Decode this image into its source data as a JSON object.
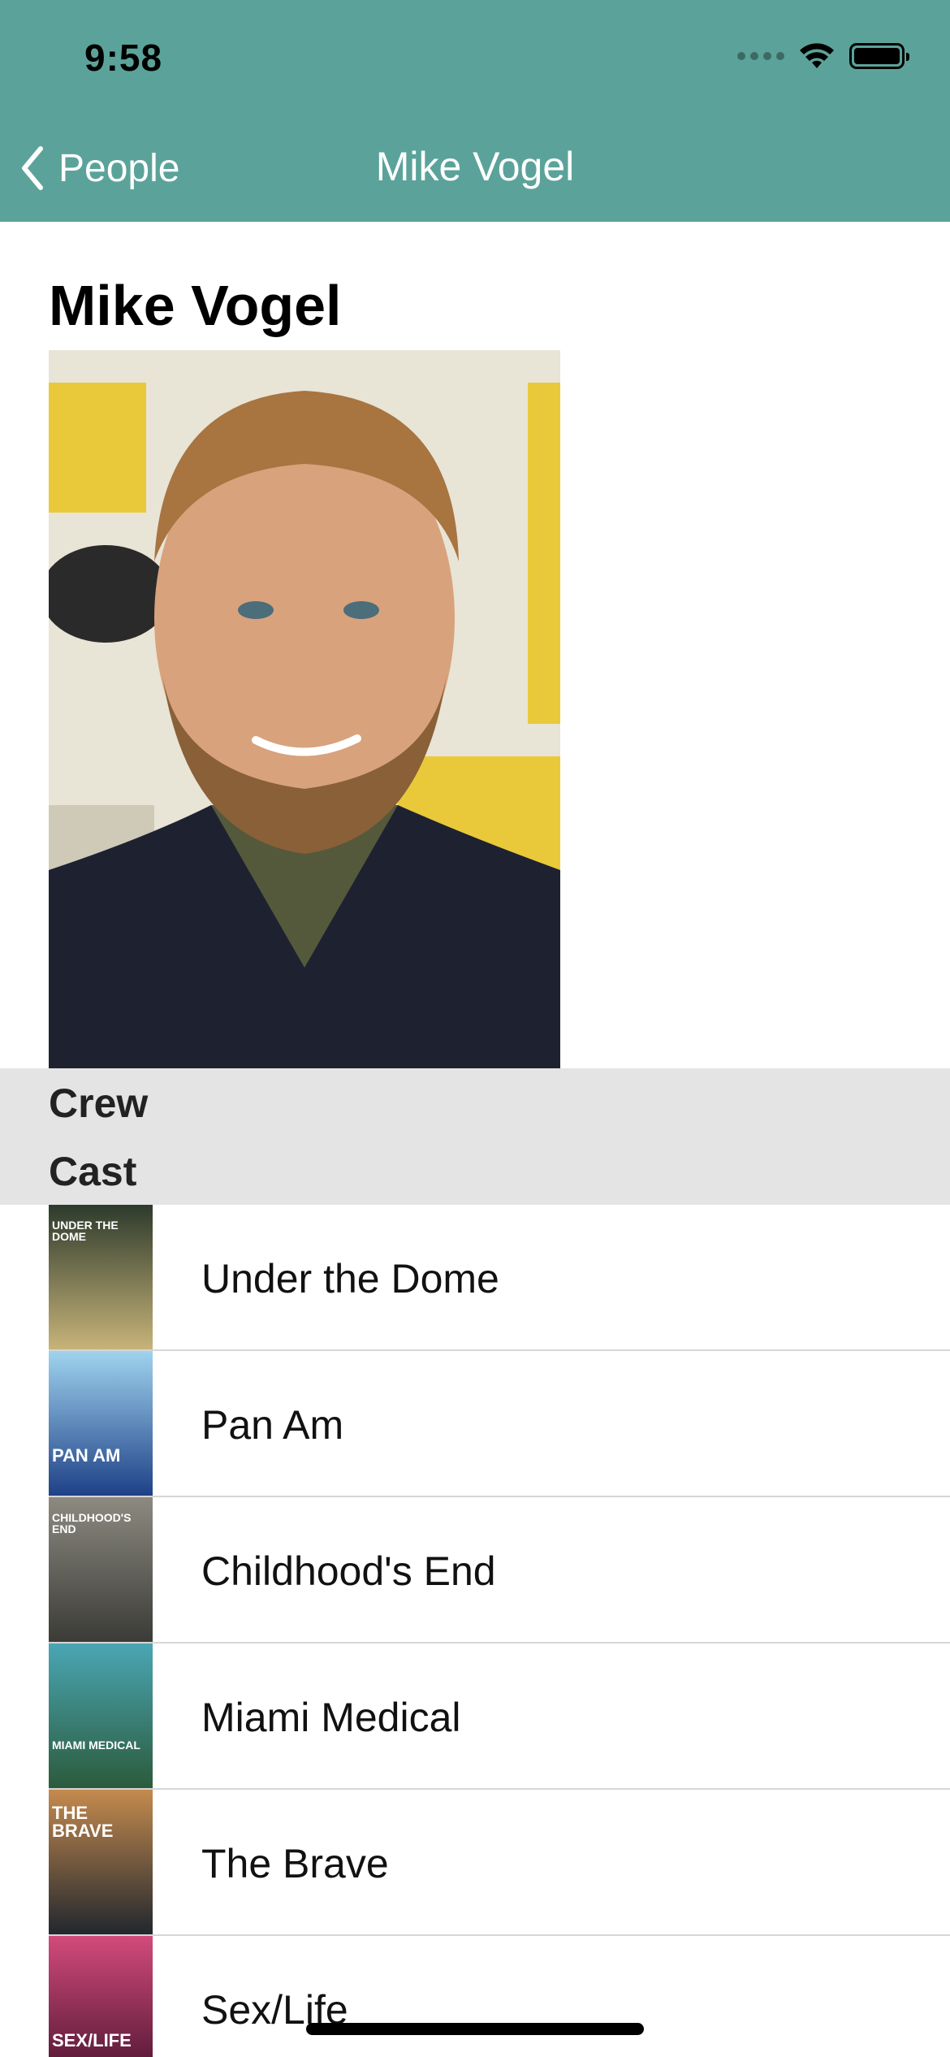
{
  "status_bar": {
    "time": "9:58"
  },
  "nav": {
    "back_label": "People",
    "title": "Mike Vogel"
  },
  "person": {
    "name": "Mike Vogel",
    "photo_alt": "portrait-photo"
  },
  "sections": {
    "crew": "Crew",
    "cast": "Cast"
  },
  "cast": [
    {
      "title": "Under the Dome",
      "poster_text": "UNDER THE DOME",
      "poster_colors": [
        "#2d3a2c",
        "#c9b57a"
      ]
    },
    {
      "title": "Pan Am",
      "poster_text": "PAN AM",
      "poster_colors": [
        "#9fd3ee",
        "#1d3f86"
      ]
    },
    {
      "title": "Childhood's End",
      "poster_text": "CHILDHOOD'S END",
      "poster_colors": [
        "#8c8a80",
        "#3a3a36"
      ]
    },
    {
      "title": "Miami Medical",
      "poster_text": "MIAMI MEDICAL",
      "poster_colors": [
        "#4aa6b4",
        "#2b5a3b"
      ]
    },
    {
      "title": "The Brave",
      "poster_text": "THE BRAVE",
      "poster_colors": [
        "#c48a4e",
        "#20262e"
      ]
    },
    {
      "title": "Sex/Life",
      "poster_text": "SEX/LIFE",
      "poster_colors": [
        "#d24a7a",
        "#4a1430"
      ]
    }
  ],
  "colors": {
    "nav_background": "#5ba39a",
    "section_band": "#e4e4e4"
  }
}
